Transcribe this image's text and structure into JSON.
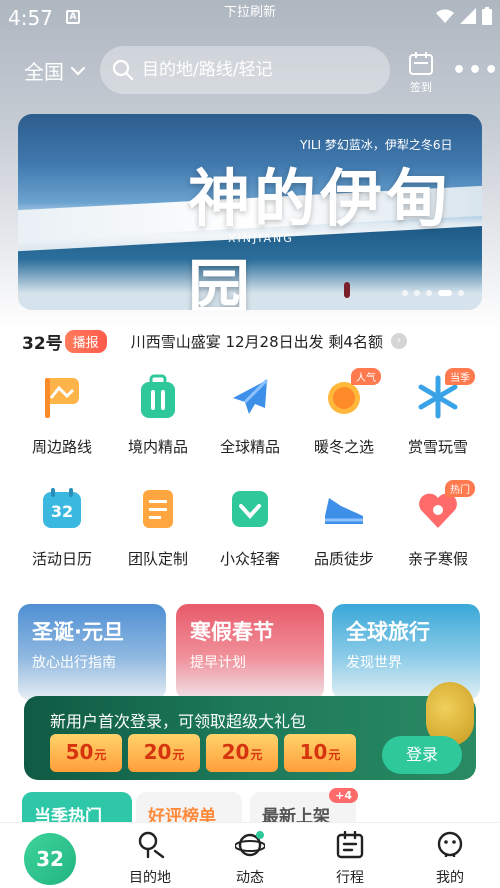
{
  "status_bar": {
    "time": "4:57",
    "notification_letter": "A",
    "pull_hint": "下拉刷新"
  },
  "header": {
    "region": "全国",
    "search_placeholder": "目的地/路线/轻记",
    "signin_label": "签到",
    "more_label": "•••"
  },
  "banner": {
    "headline": "神的伊甸园",
    "subtitle": "YILI 梦幻蓝冰，伊犁之冬6日",
    "latin": "XINJIANG",
    "slide_count": 5,
    "active_slide": 4
  },
  "notice": {
    "brand": "32号",
    "tag": "播报",
    "text": "川西雪山盛宴 12月28日出发 剩4名额",
    "arrow": "›"
  },
  "categories": [
    {
      "label": "周边路线",
      "icon": "flag-icon",
      "color": "#ff9a3c",
      "badge": ""
    },
    {
      "label": "境内精品",
      "icon": "luggage-icon",
      "color": "#2ec89a",
      "badge": ""
    },
    {
      "label": "全球精品",
      "icon": "plane-icon",
      "color": "#3e8fe8",
      "badge": ""
    },
    {
      "label": "暖冬之选",
      "icon": "sun-icon",
      "color": "#ff8a2a",
      "badge": "人气"
    },
    {
      "label": "赏雪玩雪",
      "icon": "snowflake-icon",
      "color": "#3aa3e8",
      "badge": "当季"
    },
    {
      "label": "活动日历",
      "icon": "calendar-icon",
      "color": "#3ab8e0",
      "badge": "",
      "calendar_number": "32"
    },
    {
      "label": "团队定制",
      "icon": "document-icon",
      "color": "#ff9a3c",
      "badge": ""
    },
    {
      "label": "小众轻奢",
      "icon": "diamond-icon",
      "color": "#2ec89a",
      "badge": ""
    },
    {
      "label": "品质徒步",
      "icon": "shoe-icon",
      "color": "#3e8fe8",
      "badge": ""
    },
    {
      "label": "亲子寒假",
      "icon": "heart-icon",
      "color": "#ff6b6b",
      "badge": "热门"
    }
  ],
  "promo_cards": [
    {
      "title": "圣诞·元旦",
      "subtitle": "放心出行指南",
      "color": "#5a93d4"
    },
    {
      "title": "寒假春节",
      "subtitle": "提早计划",
      "color": "#e86a78"
    },
    {
      "title": "全球旅行",
      "subtitle": "发现世界",
      "color": "#4db0d8"
    }
  ],
  "login_banner": {
    "message": "新用户首次登录，可领取超级大礼包",
    "coupons": [
      {
        "amount": "50",
        "unit": "元"
      },
      {
        "amount": "20",
        "unit": "元"
      },
      {
        "amount": "20",
        "unit": "元"
      },
      {
        "amount": "10",
        "unit": "元"
      }
    ],
    "button": "登录"
  },
  "peek_tabs": [
    {
      "label": "当季热门"
    },
    {
      "label": "好评榜单"
    },
    {
      "label": "最新上架",
      "badge": "+4"
    }
  ],
  "bottom_nav": {
    "home_label": "32",
    "items": [
      {
        "label": "目的地",
        "icon": "map-pin-icon"
      },
      {
        "label": "动态",
        "icon": "planet-icon"
      },
      {
        "label": "行程",
        "icon": "itinerary-icon"
      },
      {
        "label": "我的",
        "icon": "profile-icon"
      }
    ]
  },
  "colors": {
    "accent": "#2ec89a",
    "login_bg": "#1d7a5a",
    "coupon": "#ff9e3a"
  }
}
